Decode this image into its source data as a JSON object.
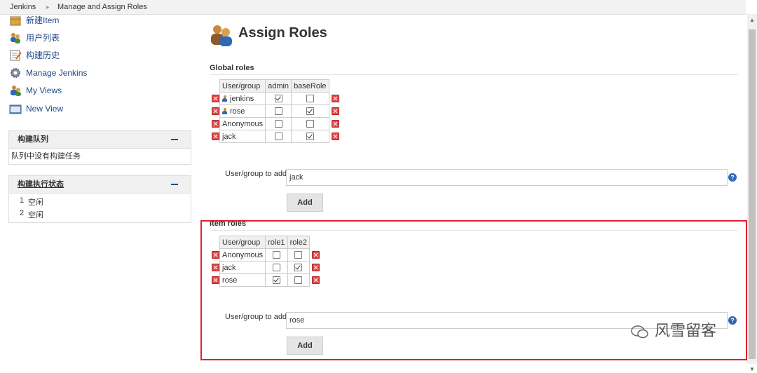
{
  "breadcrumb": {
    "items": [
      "Jenkins",
      "Manage and Assign Roles"
    ]
  },
  "sidebar": {
    "items": [
      {
        "label": "新建Item",
        "icon": "new-item-icon"
      },
      {
        "label": "用户列表",
        "icon": "people-icon"
      },
      {
        "label": "构建历史",
        "icon": "notepad-icon"
      },
      {
        "label": "Manage Jenkins",
        "icon": "gear-icon"
      },
      {
        "label": "My Views",
        "icon": "user-icon"
      },
      {
        "label": "New View",
        "icon": "folder-icon"
      }
    ],
    "queue": {
      "title": "构建队列",
      "empty_text": "队列中没有构建任务"
    },
    "executors": {
      "title": "构建执行状态",
      "rows": [
        {
          "num": "1",
          "status": "空闲"
        },
        {
          "num": "2",
          "status": "空闲"
        }
      ]
    }
  },
  "page": {
    "title": "Assign Roles"
  },
  "global_roles": {
    "section_title": "Global roles",
    "headers": [
      "User/group",
      "admin",
      "baseRole"
    ],
    "rows": [
      {
        "name": "jenkins",
        "user_icon": true,
        "checks": [
          true,
          false
        ]
      },
      {
        "name": "rose",
        "user_icon": true,
        "checks": [
          false,
          true
        ]
      },
      {
        "name": "Anonymous",
        "user_icon": false,
        "checks": [
          false,
          false
        ]
      },
      {
        "name": "jack",
        "user_icon": false,
        "checks": [
          false,
          true
        ]
      }
    ],
    "add_label": "User/group to add",
    "add_value": "jack",
    "add_button": "Add"
  },
  "item_roles": {
    "section_title": "Item roles",
    "headers": [
      "User/group",
      "role1",
      "role2"
    ],
    "rows": [
      {
        "name": "Anonymous",
        "user_icon": false,
        "checks": [
          false,
          false
        ]
      },
      {
        "name": "jack",
        "user_icon": false,
        "checks": [
          false,
          true
        ]
      },
      {
        "name": "rose",
        "user_icon": false,
        "checks": [
          true,
          false
        ]
      }
    ],
    "add_label": "User/group to add",
    "add_value": "rose",
    "add_button": "Add"
  },
  "watermark": {
    "text": "风雪留客"
  },
  "colors": {
    "link": "#204a87",
    "highlight_border": "#e0202c",
    "delete_icon": "#e04848"
  }
}
